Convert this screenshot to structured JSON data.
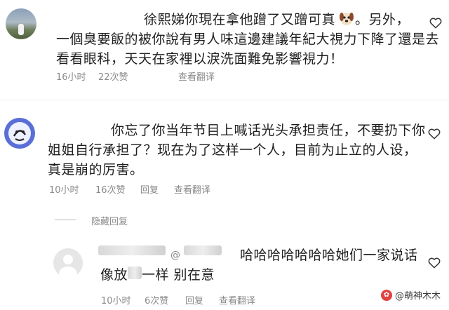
{
  "comments": [
    {
      "text_lines": [
        "徐熙娣你現在拿他蹭了又蹭可真",
        "一個臭要飯的被你說有男人味這邊建議年紀大視力下降了還是去",
        "看看眼科，天天在家裡以淚洗面難免影響視力！"
      ],
      "text_after_emoji": "。另外，",
      "emoji": "dog-face-emoji",
      "time": "16小时",
      "likes": "22次赞",
      "action": "查看翻译"
    },
    {
      "text_lines": [
        "你忘了你当年节目上喊话光头承担责任，不要扔下你",
        "姐姐自行承担了？现在为了这样一个人，目前为止立的人设，",
        "真是崩的厉害。"
      ],
      "time": "10小时",
      "likes": "16次赞",
      "reply": "回复",
      "action": "查看翻译",
      "hide_replies": "隐藏回复"
    },
    {
      "mention": "@",
      "text_lines": [
        "哈哈哈哈哈哈哈她们一家说话",
        "像放",
        "一样 别在意"
      ],
      "time": "10小时",
      "likes": "6次赞",
      "reply": "回复",
      "action": "查看翻译"
    }
  ],
  "watermark": "@萌神木木",
  "colors": {
    "text": "#1f1f1f",
    "meta": "#8a8a8a",
    "heart": "#333333"
  }
}
